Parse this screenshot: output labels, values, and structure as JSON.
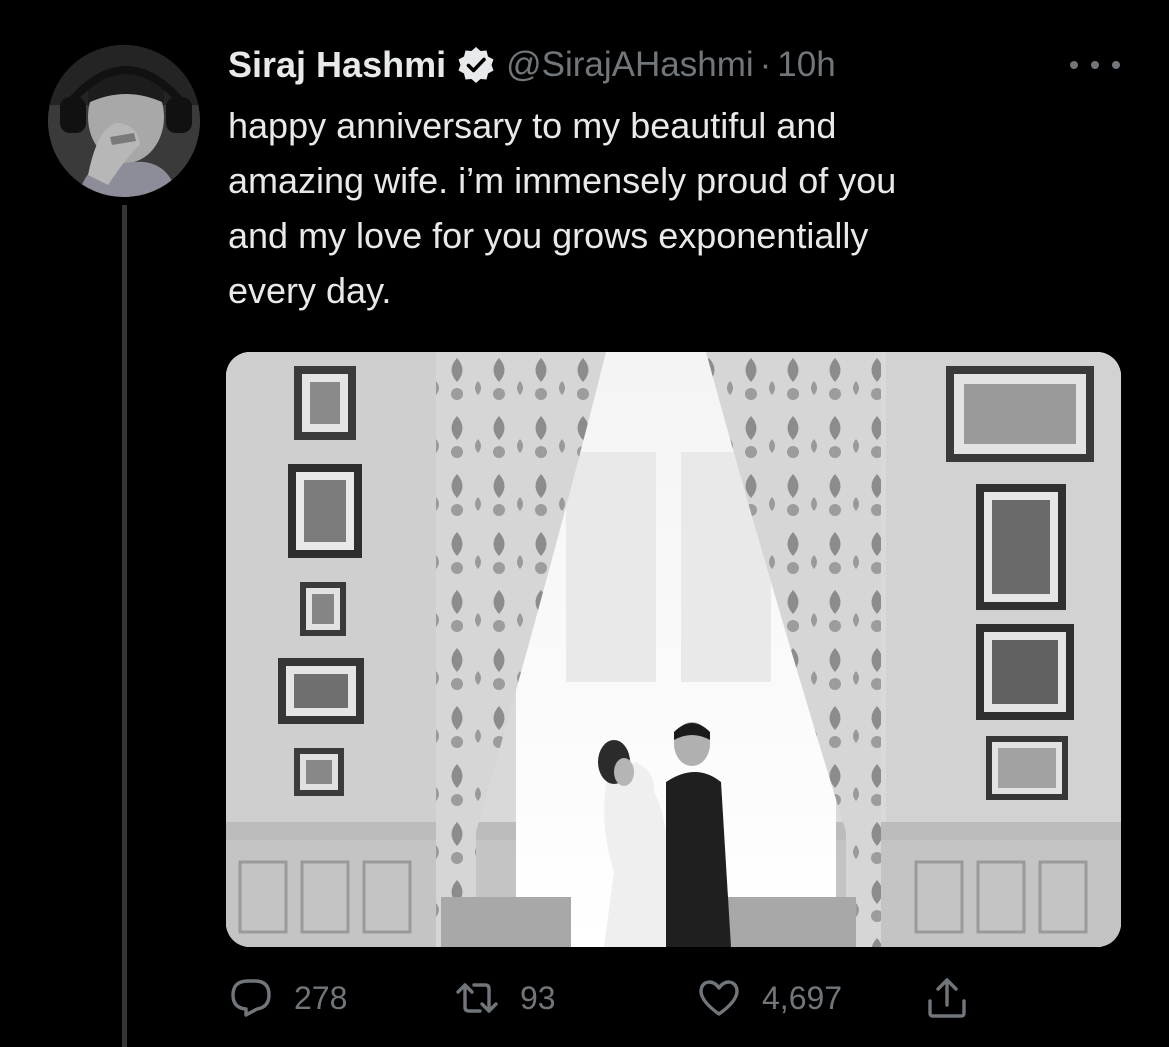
{
  "tweet": {
    "author": {
      "display_name": "Siraj Hashmi",
      "handle": "@SirajAHashmi",
      "verified": true
    },
    "separator": "·",
    "time": "10h",
    "text": "happy anniversary to my beautiful and\namazing wife. i’m immensely proud of you\nand my love for you grows exponentially\nevery day.",
    "media": {
      "description_icon": "photo"
    },
    "actions": {
      "reply_count": "278",
      "retweet_count": "93",
      "like_count": "4,697"
    }
  },
  "colors": {
    "background": "#000000",
    "primary_text": "#e7e9ea",
    "secondary_text": "#71767b",
    "thread_line": "#333639"
  },
  "icons": {
    "verified": "verified-badge-icon",
    "more": "more-icon",
    "reply": "reply-icon",
    "retweet": "retweet-icon",
    "like": "like-icon",
    "share": "share-icon"
  }
}
